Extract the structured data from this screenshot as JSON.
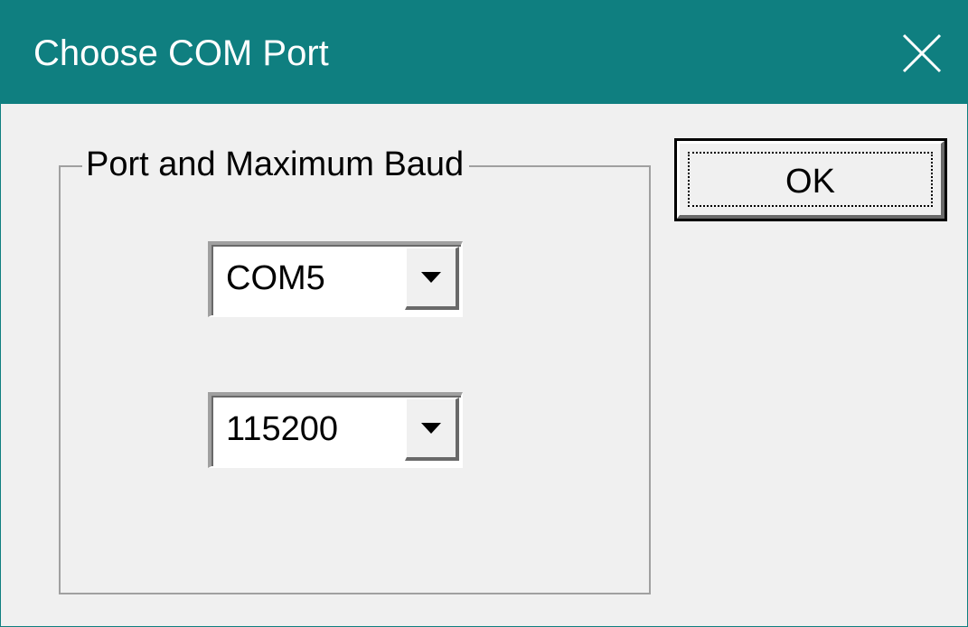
{
  "window": {
    "title": "Choose COM Port",
    "close_icon": "close-icon",
    "titlebar_color": "#0f7f80"
  },
  "group": {
    "legend": "Port and Maximum Baud"
  },
  "port_combo": {
    "value": "COM5",
    "arrow_icon": "chevron-down-icon"
  },
  "baud_combo": {
    "value": "115200",
    "arrow_icon": "chevron-down-icon"
  },
  "buttons": {
    "ok_label": "OK"
  }
}
